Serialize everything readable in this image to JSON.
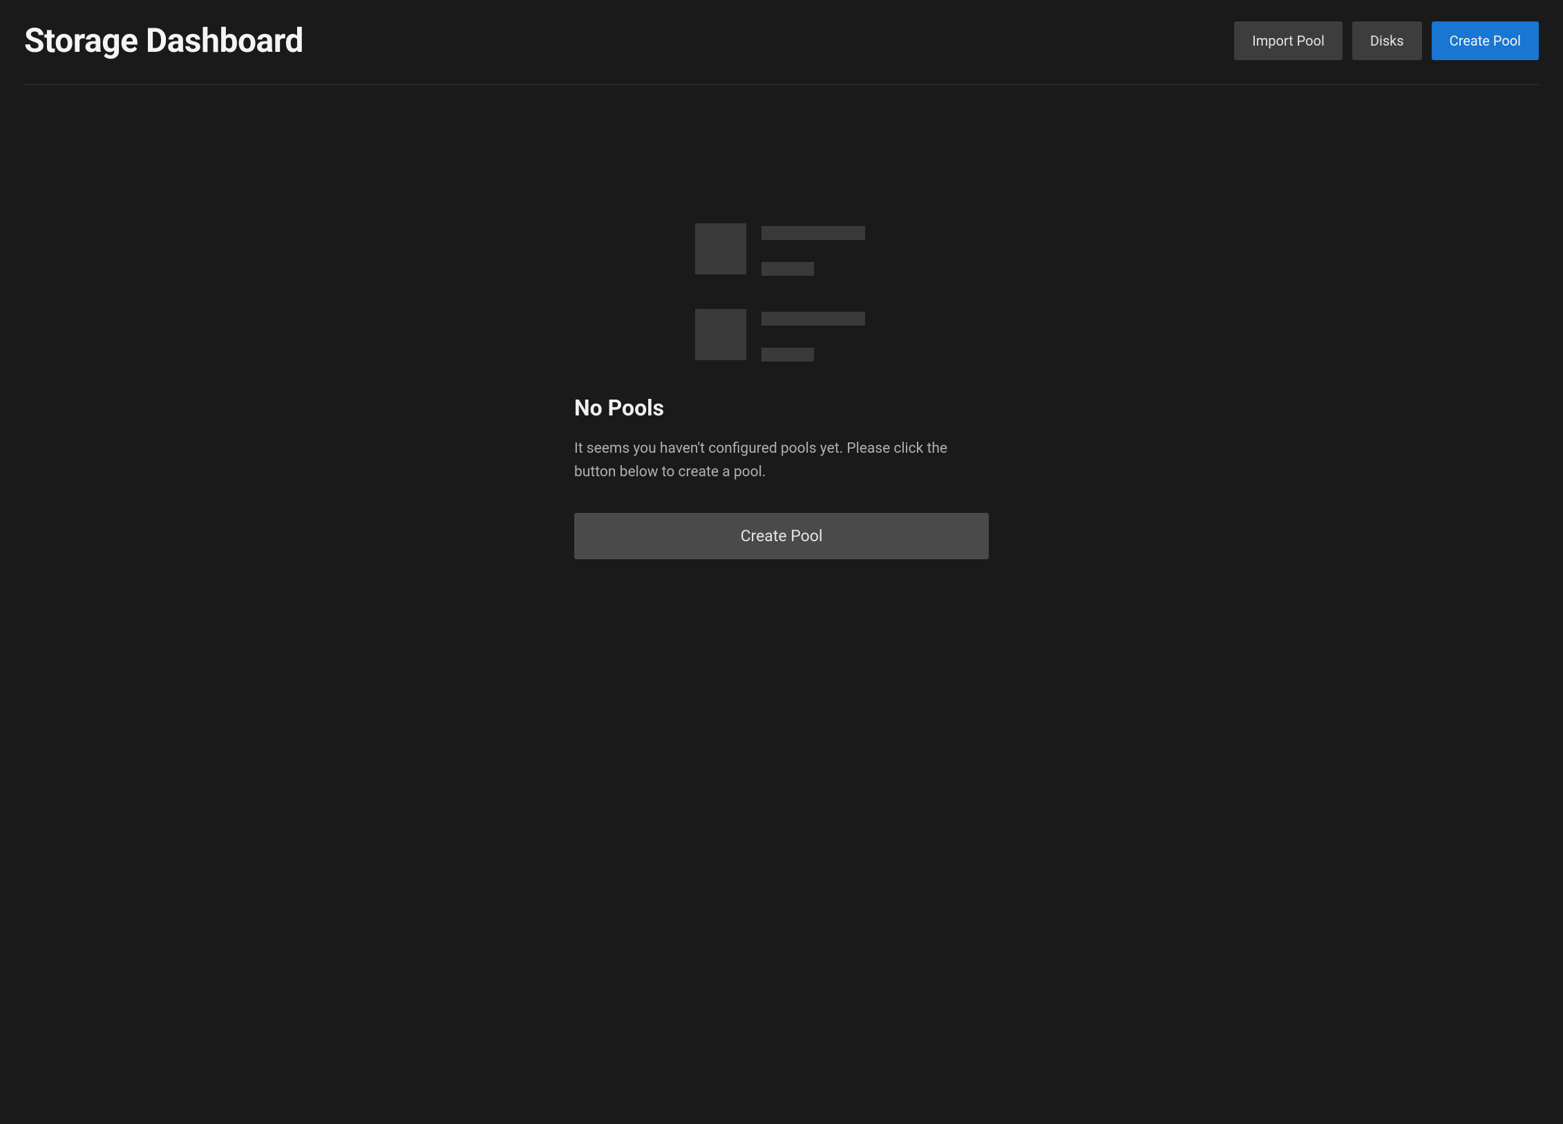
{
  "header": {
    "title": "Storage Dashboard",
    "actions": {
      "import_pool": "Import Pool",
      "disks": "Disks",
      "create_pool": "Create Pool"
    }
  },
  "empty_state": {
    "title": "No Pools",
    "description": "It seems you haven't configured pools yet. Please click the button below to create a pool.",
    "cta_label": "Create Pool"
  }
}
